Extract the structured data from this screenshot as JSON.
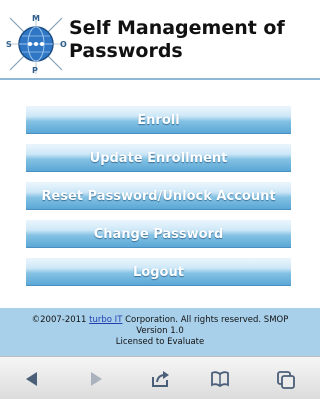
{
  "app": {
    "title": "Self Management of Passwords",
    "logo": {
      "letters": [
        "M",
        "S",
        "O",
        "P"
      ],
      "icon": "globe-network-icon"
    }
  },
  "buttons": [
    {
      "label": "Enroll"
    },
    {
      "label": "Update Enrollment"
    },
    {
      "label": "Reset Password/Unlock Account"
    },
    {
      "label": "Change Password"
    },
    {
      "label": "Logout"
    }
  ],
  "footer": {
    "copyright_prefix": "©2007-2011 ",
    "link_text": "turbo IT",
    "copyright_suffix": " Corporation. All rights reserved. SMOP",
    "version": "Version 1.0",
    "license": "Licensed to Evaluate"
  },
  "browser_toolbar": {
    "icons": [
      "back-arrow-icon",
      "forward-arrow-icon",
      "share-icon",
      "bookmarks-book-icon",
      "tabs-icon"
    ]
  },
  "colors": {
    "button_gradient_top": "#e9f5fd",
    "button_gradient_bottom": "#5aa7d6",
    "footer_bg": "#a9d0ea",
    "link": "#1f3fae"
  }
}
